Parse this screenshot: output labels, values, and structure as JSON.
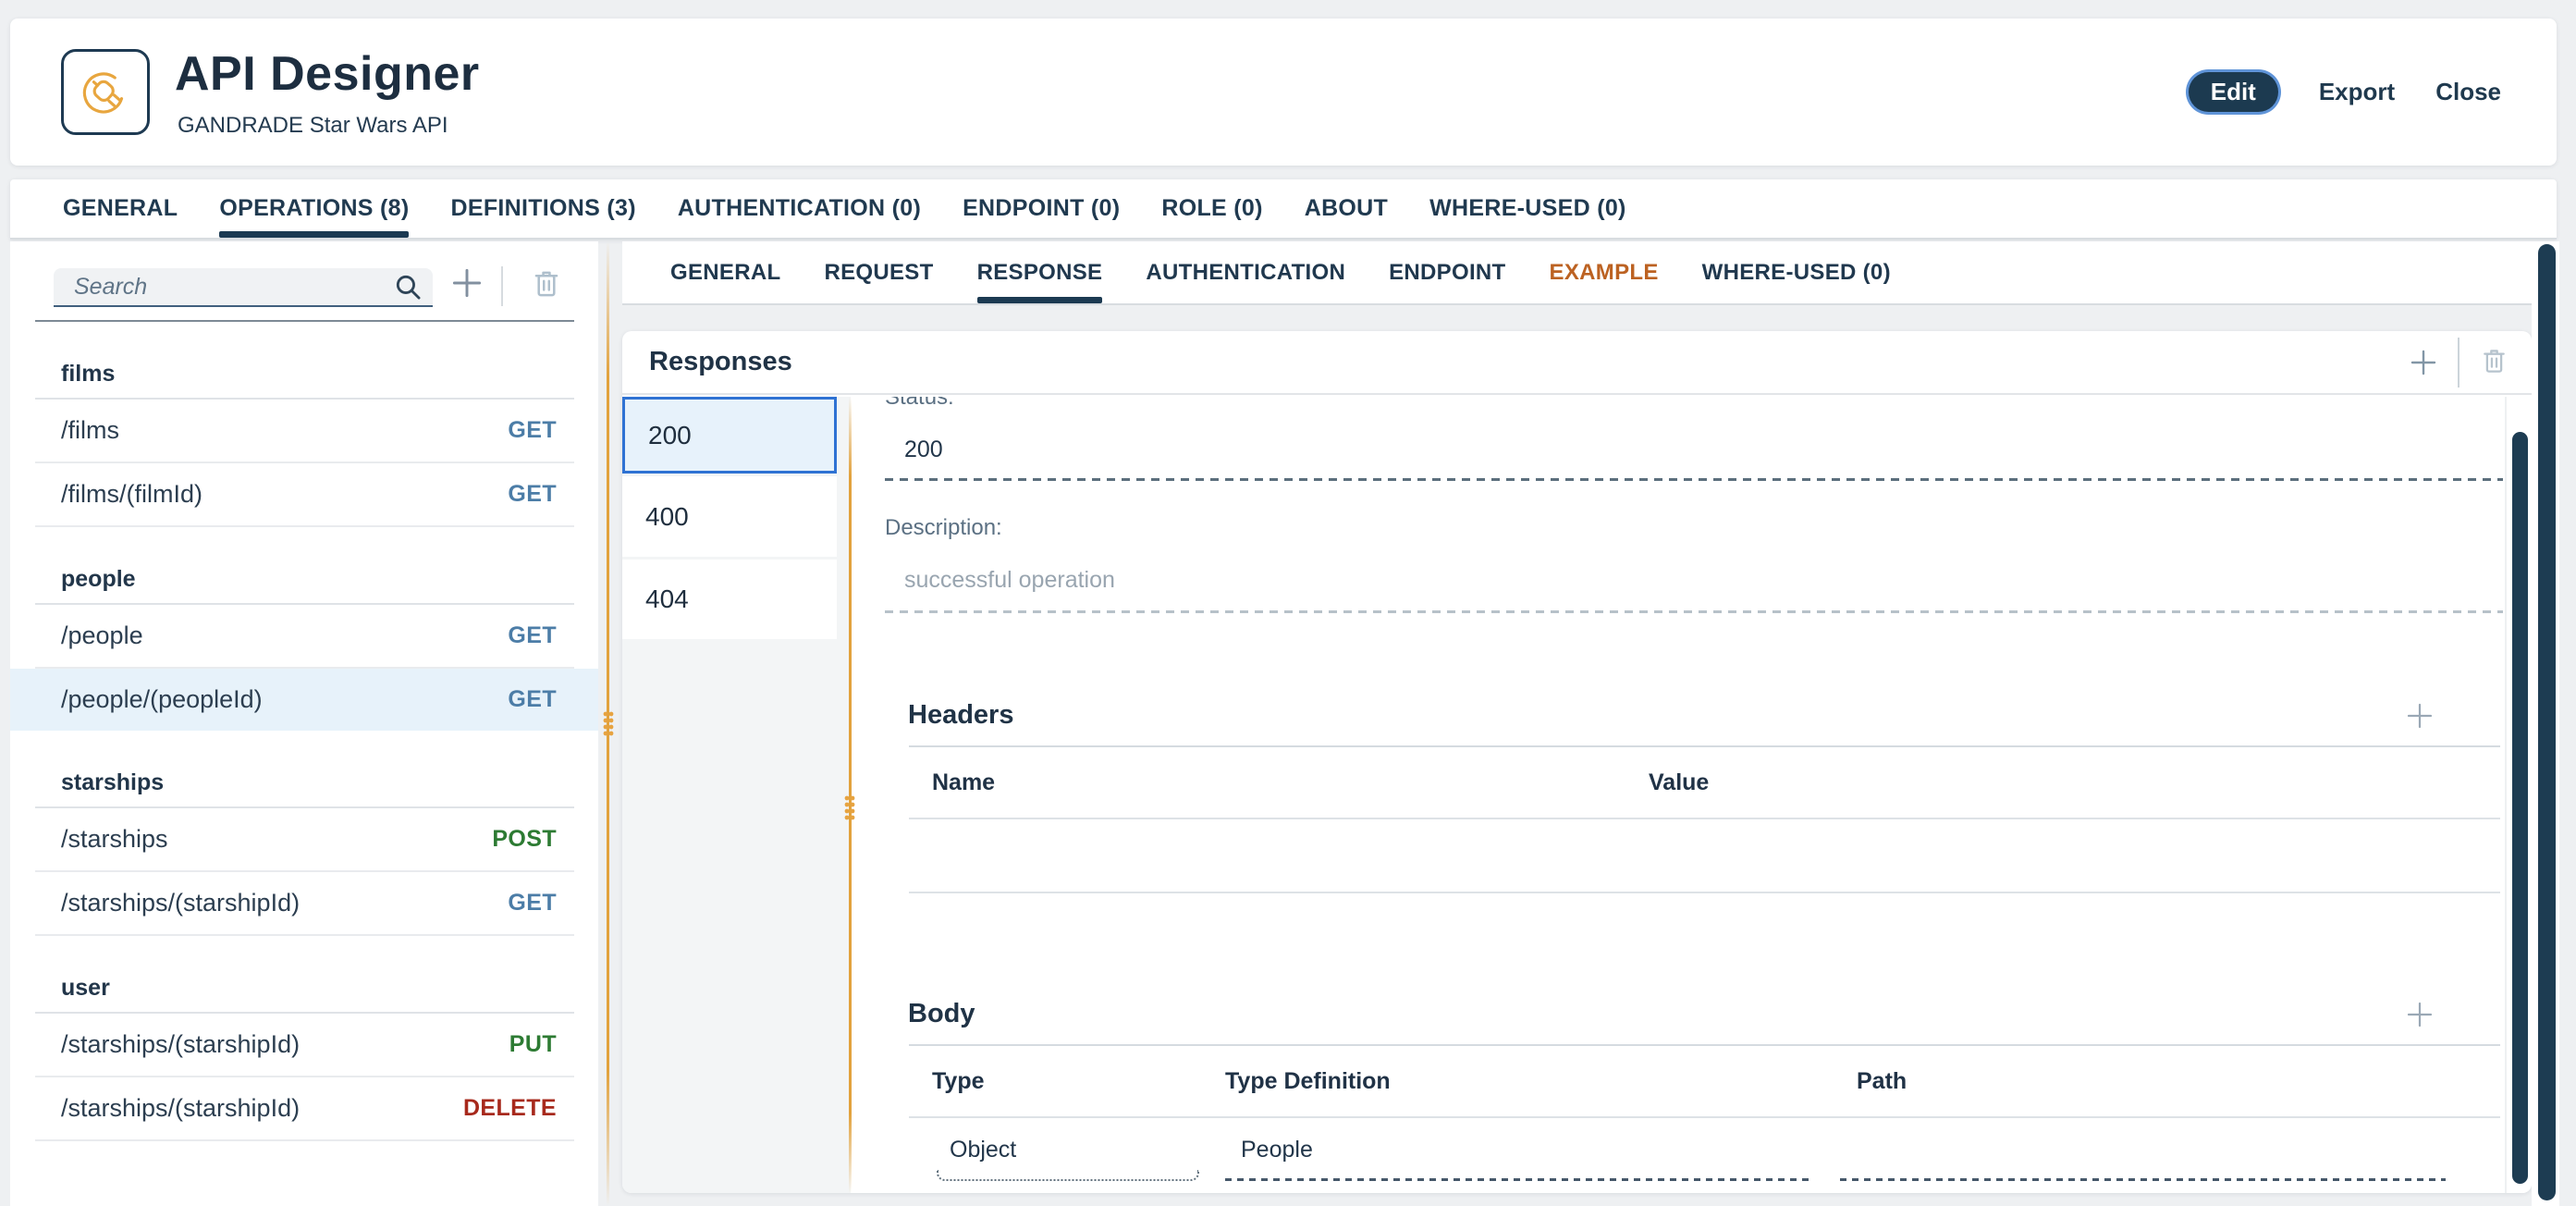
{
  "app": {
    "title": "API Designer",
    "subtitle": "GANDRADE Star Wars API"
  },
  "header_actions": {
    "edit": "Edit",
    "export": "Export",
    "close": "Close"
  },
  "main_tabs": [
    {
      "label": "GENERAL"
    },
    {
      "label": "OPERATIONS (8)"
    },
    {
      "label": "DEFINITIONS (3)"
    },
    {
      "label": "AUTHENTICATION (0)"
    },
    {
      "label": "ENDPOINT (0)"
    },
    {
      "label": "ROLE (0)"
    },
    {
      "label": "ABOUT"
    },
    {
      "label": "WHERE-USED (0)"
    }
  ],
  "sidebar": {
    "search_placeholder": "Search",
    "groups": [
      {
        "name": "films",
        "items": [
          {
            "path": "/films",
            "method": "GET"
          },
          {
            "path": "/films/(filmId)",
            "method": "GET"
          }
        ]
      },
      {
        "name": "people",
        "items": [
          {
            "path": "/people",
            "method": "GET"
          },
          {
            "path": "/people/(peopleId)",
            "method": "GET"
          }
        ]
      },
      {
        "name": "starships",
        "items": [
          {
            "path": "/starships",
            "method": "POST"
          },
          {
            "path": "/starships/(starshipId)",
            "method": "GET"
          }
        ]
      },
      {
        "name": "user",
        "items": [
          {
            "path": "/starships/(starshipId)",
            "method": "PUT"
          },
          {
            "path": "/starships/(starshipId)",
            "method": "DELETE"
          }
        ]
      }
    ]
  },
  "operation_tabs": [
    {
      "label": "GENERAL"
    },
    {
      "label": "REQUEST"
    },
    {
      "label": "RESPONSE"
    },
    {
      "label": "AUTHENTICATION"
    },
    {
      "label": "ENDPOINT"
    },
    {
      "label": "EXAMPLE"
    },
    {
      "label": "WHERE-USED (0)"
    }
  ],
  "responses": {
    "title": "Responses",
    "status_codes": [
      "200",
      "400",
      "404"
    ],
    "selected_status": "200",
    "fields": {
      "status_label": "Status:",
      "status_value": "200",
      "description_label": "Description:",
      "description_placeholder": "successful operation"
    },
    "headers_section": {
      "title": "Headers",
      "columns": {
        "name": "Name",
        "value": "Value"
      }
    },
    "body_section": {
      "title": "Body",
      "columns": {
        "type": "Type",
        "type_definition": "Type Definition",
        "path": "Path"
      },
      "row": {
        "type": "Object",
        "type_definition": "People",
        "path": ""
      }
    }
  },
  "icons": {
    "logo": "plug-circle",
    "search": "magnifier",
    "add": "plus",
    "delete": "trash",
    "drag": "grip-dots"
  },
  "colors": {
    "accent_navy": "#1c3a52",
    "method_get": "#4c7da7",
    "method_post": "#2d7b33",
    "method_put": "#2d7b33",
    "method_delete": "#a7291c",
    "example_tab": "#bc6222",
    "selected_row_bg": "#e7f2fa",
    "selected_status_border": "#2f72d3",
    "splitter_gold": "#e2a23d",
    "scrollbar_thumb": "#1d3c52"
  }
}
